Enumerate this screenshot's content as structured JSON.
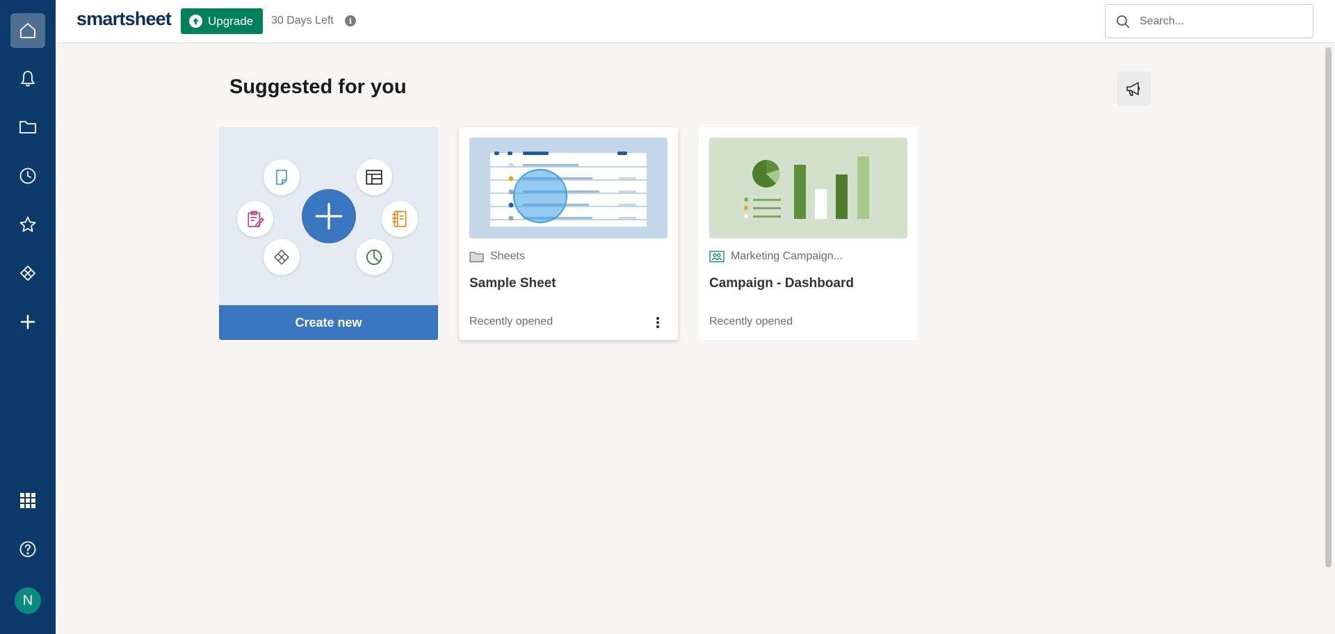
{
  "app": {
    "logo_text": "smartsheet"
  },
  "topbar": {
    "upgrade_label": "Upgrade",
    "trial_text": "30 Days Left",
    "info_glyph": "i",
    "search_placeholder": "Search..."
  },
  "sidebar": {
    "items": [
      {
        "name": "home",
        "icon": "home-icon",
        "active": true
      },
      {
        "name": "notifications",
        "icon": "bell-icon"
      },
      {
        "name": "browse",
        "icon": "folder-icon"
      },
      {
        "name": "recents",
        "icon": "clock-icon"
      },
      {
        "name": "favorites",
        "icon": "star-icon"
      },
      {
        "name": "workapps",
        "icon": "workapps-icon"
      },
      {
        "name": "create",
        "icon": "plus-icon"
      },
      {
        "name": "launcher",
        "icon": "grid-icon"
      },
      {
        "name": "help",
        "icon": "help-icon"
      }
    ],
    "avatar_initial": "N"
  },
  "main": {
    "section_title": "Suggested for you",
    "create_card": {
      "button_label": "Create new"
    },
    "cards": [
      {
        "location": "Sheets",
        "title": "Sample Sheet",
        "footer": "Recently opened",
        "location_icon": "folder-icon"
      },
      {
        "location": "Marketing Campaign...",
        "title": "Campaign - Dashboard",
        "footer": "Recently opened",
        "location_icon": "workspace-icon"
      }
    ]
  },
  "colors": {
    "sidebar": "#0b3a6b",
    "upgrade": "#00805a",
    "primary": "#3a76bf",
    "avatar": "#0b8a7f"
  }
}
